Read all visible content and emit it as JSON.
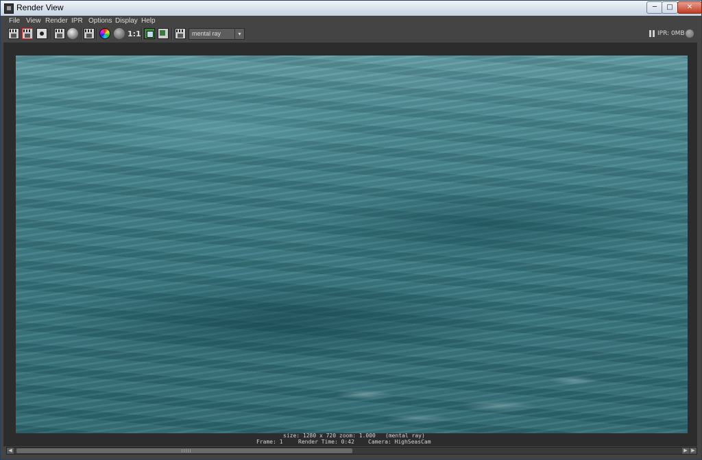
{
  "window": {
    "title": "Render View",
    "controls": {
      "minimize": "─",
      "maximize": "□",
      "close": "✕"
    }
  },
  "menubar": {
    "items": [
      "File",
      "View",
      "Render",
      "IPR",
      "Options",
      "Display",
      "Help"
    ]
  },
  "toolbar": {
    "icons": [
      "redo-render-icon",
      "render-region-icon",
      "snapshot-icon",
      "ipr-render-icon",
      "refresh-ipr-icon",
      "render-settings-icon",
      "rgb-channels-icon",
      "alpha-channel-icon",
      "keep-image-icon",
      "remove-image-icon",
      "render-camera-icon"
    ],
    "ratio_label": "1:1",
    "renderer": {
      "selected": "mental ray",
      "arrow": "▾"
    },
    "ipr_memory": "IPR: 0MB"
  },
  "status": {
    "size": "size: 1280 x 720 zoom: 1.000",
    "renderer": "(mental ray)",
    "frame": "Frame: 1",
    "render_time": "Render Time: 0:42",
    "camera": "Camera: HighSeasCam"
  },
  "scrollbar": {
    "left_arrow": "◀",
    "right_arrow": "▶",
    "thumb_fraction": 0.49
  },
  "colors": {
    "panel": "#444444",
    "viewport": "#2c2c2c",
    "ocean": "#3e7d86",
    "render_region_highlight": "#dd2222"
  }
}
